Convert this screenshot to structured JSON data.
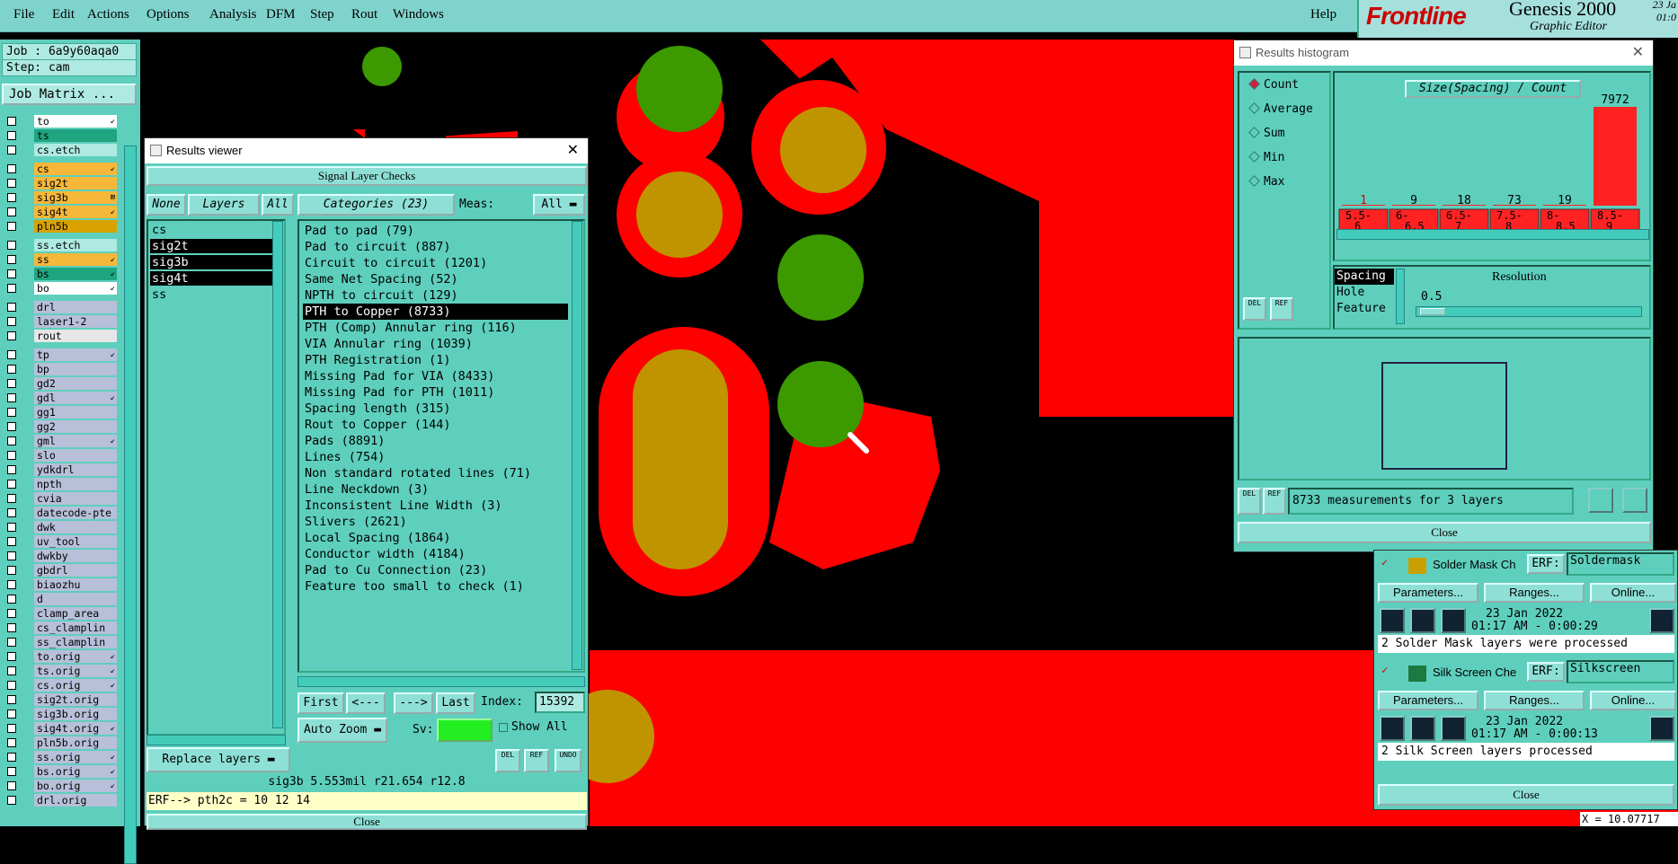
{
  "menubar": {
    "items": [
      "File",
      "Edit",
      "Actions",
      "Options",
      "Analysis",
      "DFM",
      "Step",
      "Rout",
      "Windows"
    ],
    "help": "Help"
  },
  "logo": {
    "brand_a": "Frontline",
    "brand_b": "",
    "product": "Genesis 2000",
    "subtitle": "Graphic Editor",
    "date_line1": "23 Ja",
    "date_line2": "01:0"
  },
  "job": {
    "job_line": "Job : 6a9y60aqa0",
    "step_line": "Step: cam",
    "matrix_button": "Job Matrix ..."
  },
  "layers": [
    {
      "name": "to",
      "color": "#ffffff",
      "icon": "↙"
    },
    {
      "name": "ts",
      "color": "#1fa57f",
      "icon": ""
    },
    {
      "name": "cs.etch",
      "color": "#aeeae1",
      "icon": ""
    },
    {
      "name": "cs",
      "color": "#f7b83a",
      "icon": "↙"
    },
    {
      "name": "sig2t",
      "color": "#f7b83a",
      "icon": ""
    },
    {
      "name": "sig3b",
      "color": "#f7b83a",
      "icon": "⊠"
    },
    {
      "name": "sig4t",
      "color": "#f7b83a",
      "icon": "↙"
    },
    {
      "name": "pln5b",
      "color": "#d9a200",
      "icon": ""
    },
    {
      "name": "ss.etch",
      "color": "#aeeae1",
      "icon": ""
    },
    {
      "name": "ss",
      "color": "#f7b83a",
      "icon": "↙"
    },
    {
      "name": "bs",
      "color": "#1fa57f",
      "icon": "↙"
    },
    {
      "name": "bo",
      "color": "#ffffff",
      "icon": "↙"
    },
    {
      "name": "drl",
      "color": "#b7bfd9",
      "icon": ""
    },
    {
      "name": "laser1-2",
      "color": "#b7bfd9",
      "icon": ""
    },
    {
      "name": "rout",
      "color": "#e6e6e6",
      "icon": ""
    },
    {
      "name": "tp",
      "color": "#b7bfd9",
      "icon": "↙"
    },
    {
      "name": "bp",
      "color": "#b7bfd9",
      "icon": ""
    },
    {
      "name": "gd2",
      "color": "#b7bfd9",
      "icon": ""
    },
    {
      "name": "gdl",
      "color": "#b7bfd9",
      "icon": "↙"
    },
    {
      "name": "gg1",
      "color": "#b7bfd9",
      "icon": ""
    },
    {
      "name": "gg2",
      "color": "#b7bfd9",
      "icon": ""
    },
    {
      "name": "gml",
      "color": "#b7bfd9",
      "icon": "↙"
    },
    {
      "name": "slo",
      "color": "#b7bfd9",
      "icon": ""
    },
    {
      "name": "ydkdrl",
      "color": "#b7bfd9",
      "icon": ""
    },
    {
      "name": "npth",
      "color": "#b7bfd9",
      "icon": ""
    },
    {
      "name": "cvia",
      "color": "#b7bfd9",
      "icon": ""
    },
    {
      "name": "datecode-pte",
      "color": "#b7bfd9",
      "icon": ""
    },
    {
      "name": "dwk",
      "color": "#b7bfd9",
      "icon": ""
    },
    {
      "name": "uv_tool",
      "color": "#b7bfd9",
      "icon": ""
    },
    {
      "name": "dwkby",
      "color": "#b7bfd9",
      "icon": ""
    },
    {
      "name": "gbdrl",
      "color": "#b7bfd9",
      "icon": ""
    },
    {
      "name": "biaozhu",
      "color": "#b7bfd9",
      "icon": ""
    },
    {
      "name": "d",
      "color": "#b7bfd9",
      "icon": ""
    },
    {
      "name": "clamp_area",
      "color": "#b7bfd9",
      "icon": ""
    },
    {
      "name": "cs_clamplin",
      "color": "#b7bfd9",
      "icon": ""
    },
    {
      "name": "ss_clamplin",
      "color": "#b7bfd9",
      "icon": ""
    },
    {
      "name": "to.orig",
      "color": "#b7bfd9",
      "icon": "↙"
    },
    {
      "name": "ts.orig",
      "color": "#b7bfd9",
      "icon": "↙"
    },
    {
      "name": "cs.orig",
      "color": "#b7bfd9",
      "icon": "↙"
    },
    {
      "name": "sig2t.orig",
      "color": "#b7bfd9",
      "icon": ""
    },
    {
      "name": "sig3b.orig",
      "color": "#b7bfd9",
      "icon": ""
    },
    {
      "name": "sig4t.orig",
      "color": "#b7bfd9",
      "icon": "↙"
    },
    {
      "name": "pln5b.orig",
      "color": "#b7bfd9",
      "icon": ""
    },
    {
      "name": "ss.orig",
      "color": "#b7bfd9",
      "icon": "↙"
    },
    {
      "name": "bs.orig",
      "color": "#b7bfd9",
      "icon": "↙"
    },
    {
      "name": "bo.orig",
      "color": "#b7bfd9",
      "icon": "↙"
    },
    {
      "name": "drl.orig",
      "color": "#b7bfd9",
      "icon": ""
    }
  ],
  "results_viewer": {
    "title": "Results viewer",
    "header": "Signal Layer Checks",
    "none_btn": "None",
    "layers_btn": "Layers",
    "all_btn": "All",
    "layer_list": [
      "cs",
      "sig2t",
      "sig3b",
      "sig4t",
      "ss"
    ],
    "categories_btn": "Categories (23)",
    "meas_label": "Meas:",
    "meas_value": "All",
    "categories": [
      "Pad to pad (79)",
      "Pad to circuit (887)",
      "Circuit to circuit (1201)",
      "Same Net Spacing (52)",
      "NPTH to circuit (129)",
      "PTH to Copper (8733)",
      "PTH (Comp) Annular ring (116)",
      "VIA Annular ring (1039)",
      "PTH Registration (1)",
      "Missing Pad for VIA (8433)",
      "Missing Pad for PTH (1011)",
      "Spacing length (315)",
      "Rout to Copper (144)",
      "Pads (8891)",
      "Lines (754)",
      "Non standard rotated lines (71)",
      "Line Neckdown (3)",
      "Inconsistent Line Width (3)",
      "Slivers (2621)",
      "Local Spacing (1864)",
      "Conductor width (4184)",
      "Pad to Cu Connection (23)",
      "Feature too small to check (1)"
    ],
    "first": "First",
    "prev": "<---",
    "next": "--->",
    "last": "Last",
    "index_label": "Index:",
    "index_value": "15392",
    "auto_zoom": "Auto Zoom",
    "sv_label": "Sv:",
    "show_all": "Show All",
    "replace_layers": "Replace layers",
    "del": "DEL",
    "ref": "REF",
    "undo": "UNDO",
    "status": "sig3b 5.553mil  r21.654  r12.8",
    "erf": "ERF--> pth2c = 10 12 14",
    "close": "Close"
  },
  "histogram": {
    "title": "Results histogram",
    "options": [
      "Count",
      "Average",
      "Sum",
      "Min",
      "Max"
    ],
    "chart_title": "Size(Spacing) / Count",
    "counts": [
      "1",
      "9",
      "18",
      "73",
      "19",
      "7972"
    ],
    "bins": [
      [
        "5.5-",
        "6"
      ],
      [
        "6-",
        "6.5"
      ],
      [
        "6.5-",
        "7"
      ],
      [
        "7.5-",
        "8"
      ],
      [
        "8-",
        "8.5"
      ],
      [
        "8.5-",
        "9"
      ]
    ],
    "measure_list": [
      "Spacing",
      "Hole",
      "Feature"
    ],
    "resolution_label": "Resolution",
    "resolution_value": "0.5",
    "summary": "8733 measurements for 3 layers",
    "close": "Close",
    "del": "DEL",
    "ref": "REF"
  },
  "chart_data": {
    "type": "bar",
    "title": "Size(Spacing) / Count",
    "categories": [
      "5.5-6",
      "6-6.5",
      "6.5-7",
      "7.5-8",
      "8-8.5",
      "8.5-9"
    ],
    "values": [
      1,
      9,
      18,
      73,
      19,
      7972
    ],
    "xlabel": "",
    "ylabel": ""
  },
  "checklist": {
    "solder": {
      "name": "Solder Mask Ch",
      "erf_label": "ERF:",
      "erf_value": "Soldermask",
      "params": "Parameters...",
      "ranges": "Ranges...",
      "online": "Online...",
      "date": "23 Jan 2022",
      "time": "01:17 AM - 0:00:29",
      "msg": "2 Solder Mask layers were processed"
    },
    "silk": {
      "name": "Silk Screen Che",
      "erf_label": "ERF:",
      "erf_value": "Silkscreen",
      "params": "Parameters...",
      "ranges": "Ranges...",
      "online": "Online...",
      "date": "23 Jan 2022",
      "time": "01:17 AM - 0:00:13",
      "msg": "2 Silk Screen layers processed"
    },
    "close": "Close"
  },
  "coords": "X = 10.07717"
}
